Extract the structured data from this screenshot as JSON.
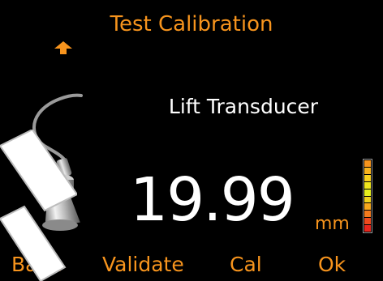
{
  "screen": {
    "title": "Test Calibration",
    "sensor_name": "Lift Transducer",
    "reading": "19.99",
    "unit": "mm",
    "level_fraction": 1.0,
    "level_colors": [
      "#f7941d",
      "#f7b21d",
      "#f7cf1d",
      "#f0e61d",
      "#e6f01d",
      "#f0d21d",
      "#f7a81d",
      "#f47a1d",
      "#ee4a1d",
      "#e8261d"
    ]
  },
  "softkeys": [
    {
      "label": "Back"
    },
    {
      "label": "Validate"
    },
    {
      "label": "Cal"
    },
    {
      "label": "Ok"
    }
  ],
  "icons": {
    "up_arrow": "up-arrow-icon",
    "transducer": "transducer-icon"
  },
  "colors": {
    "accent": "#f7941d",
    "text": "#ffffff",
    "background": "#000000"
  }
}
